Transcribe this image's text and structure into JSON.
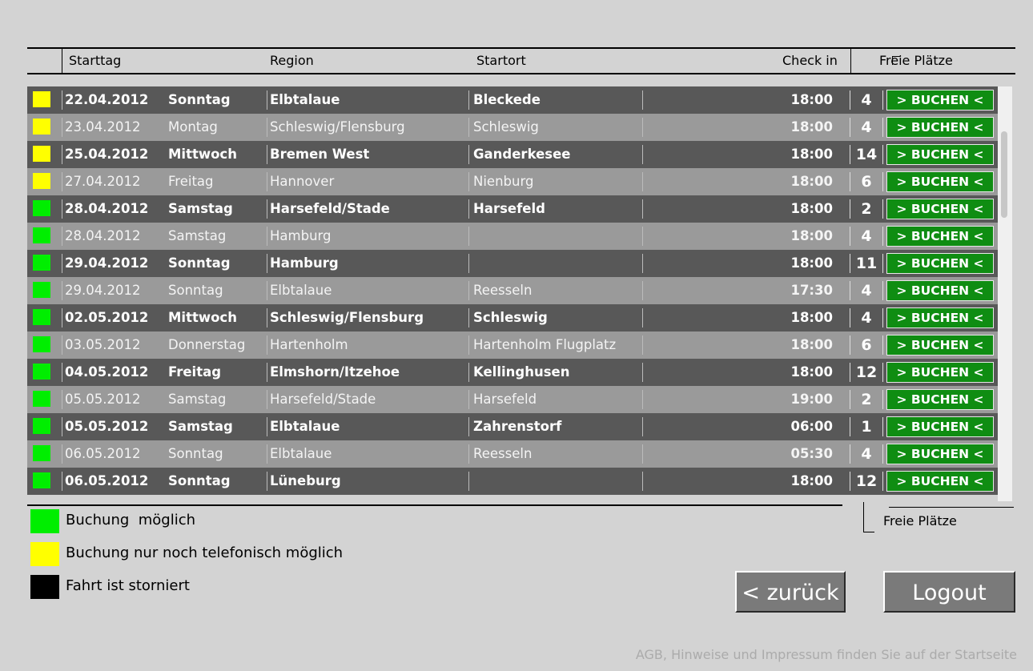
{
  "header": {
    "starttag": "Starttag",
    "region": "Region",
    "startort": "Startort",
    "checkin": "Check in",
    "freie_plaetze": "Freie Plätze"
  },
  "colors": {
    "available": "#00ee00",
    "phone_only": "#ffff00",
    "cancelled": "#000000",
    "buchen_bg": "#0f8d12"
  },
  "rows": [
    {
      "status": "phone_only",
      "date": "22.04.2012",
      "day": "Sonntag",
      "region": "Elbtalaue",
      "startort": "Bleckede",
      "checkin": "18:00",
      "seats": "4",
      "button": "> BUCHEN <"
    },
    {
      "status": "phone_only",
      "date": "23.04.2012",
      "day": "Montag",
      "region": "Schleswig/Flensburg",
      "startort": "Schleswig",
      "checkin": "18:00",
      "seats": "4",
      "button": "> BUCHEN <"
    },
    {
      "status": "phone_only",
      "date": "25.04.2012",
      "day": "Mittwoch",
      "region": "Bremen West",
      "startort": "Ganderkesee",
      "checkin": "18:00",
      "seats": "14",
      "button": "> BUCHEN <"
    },
    {
      "status": "phone_only",
      "date": "27.04.2012",
      "day": "Freitag",
      "region": "Hannover",
      "startort": "Nienburg",
      "checkin": "18:00",
      "seats": "6",
      "button": "> BUCHEN <"
    },
    {
      "status": "available",
      "date": "28.04.2012",
      "day": "Samstag",
      "region": "Harsefeld/Stade",
      "startort": "Harsefeld",
      "checkin": "18:00",
      "seats": "2",
      "button": "> BUCHEN <"
    },
    {
      "status": "available",
      "date": "28.04.2012",
      "day": "Samstag",
      "region": "Hamburg",
      "startort": "",
      "checkin": "18:00",
      "seats": "4",
      "button": "> BUCHEN <"
    },
    {
      "status": "available",
      "date": "29.04.2012",
      "day": "Sonntag",
      "region": "Hamburg",
      "startort": "",
      "checkin": "18:00",
      "seats": "11",
      "button": "> BUCHEN <"
    },
    {
      "status": "available",
      "date": "29.04.2012",
      "day": "Sonntag",
      "region": "Elbtalaue",
      "startort": "Reesseln",
      "checkin": "17:30",
      "seats": "4",
      "button": "> BUCHEN <"
    },
    {
      "status": "available",
      "date": "02.05.2012",
      "day": "Mittwoch",
      "region": "Schleswig/Flensburg",
      "startort": "Schleswig",
      "checkin": "18:00",
      "seats": "4",
      "button": "> BUCHEN <"
    },
    {
      "status": "available",
      "date": "03.05.2012",
      "day": "Donnerstag",
      "region": "Hartenholm",
      "startort": "Hartenholm Flugplatz",
      "checkin": "18:00",
      "seats": "6",
      "button": "> BUCHEN <"
    },
    {
      "status": "available",
      "date": "04.05.2012",
      "day": "Freitag",
      "region": "Elmshorn/Itzehoe",
      "startort": "Kellinghusen",
      "checkin": "18:00",
      "seats": "12",
      "button": "> BUCHEN <"
    },
    {
      "status": "available",
      "date": "05.05.2012",
      "day": "Samstag",
      "region": "Harsefeld/Stade",
      "startort": "Harsefeld",
      "checkin": "19:00",
      "seats": "2",
      "button": "> BUCHEN <"
    },
    {
      "status": "available",
      "date": "05.05.2012",
      "day": "Samstag",
      "region": "Elbtalaue",
      "startort": "Zahrenstorf",
      "checkin": "06:00",
      "seats": "1",
      "button": "> BUCHEN <"
    },
    {
      "status": "available",
      "date": "06.05.2012",
      "day": "Sonntag",
      "region": "Elbtalaue",
      "startort": "Reesseln",
      "checkin": "05:30",
      "seats": "4",
      "button": "> BUCHEN <"
    },
    {
      "status": "available",
      "date": "06.05.2012",
      "day": "Sonntag",
      "region": "Lüneburg",
      "startort": "",
      "checkin": "18:00",
      "seats": "12",
      "button": "> BUCHEN <"
    }
  ],
  "legend": {
    "available": "Buchung  möglich",
    "phone_only": "Buchung nur noch telefonisch möglich",
    "cancelled": "Fahrt ist storniert",
    "freie_plaetze": "Freie Plätze"
  },
  "buttons": {
    "back": "< zurück",
    "logout": "Logout"
  },
  "footer": "AGB, Hinweise und Impressum finden Sie auf der Startseite"
}
